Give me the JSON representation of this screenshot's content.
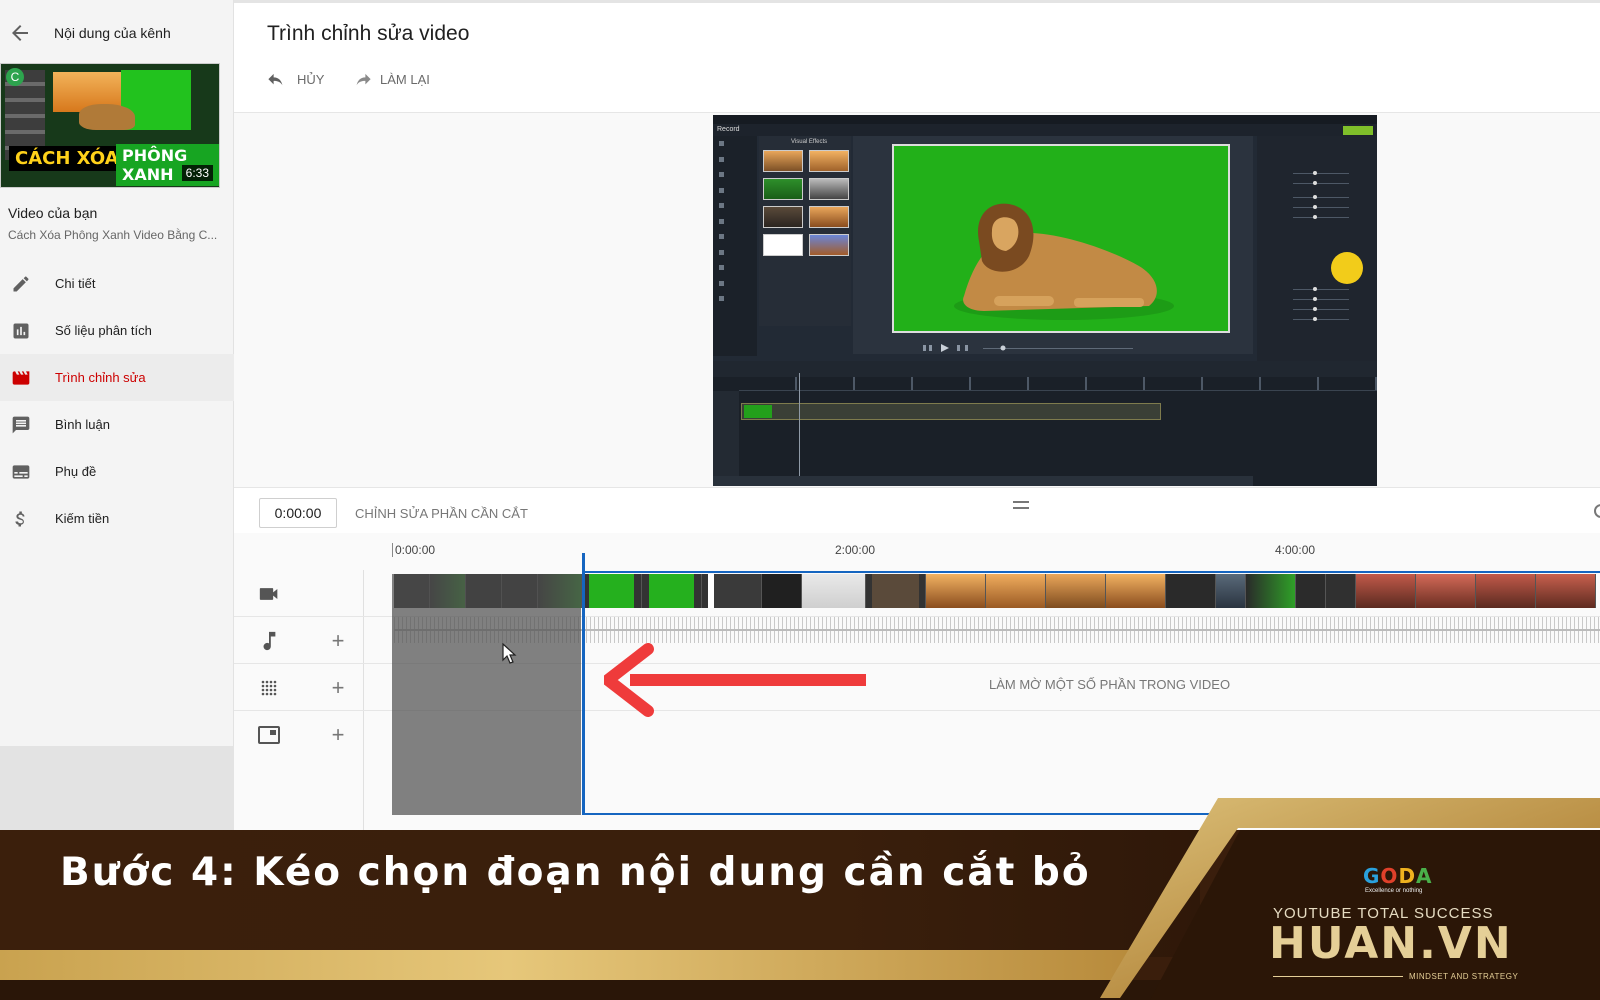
{
  "sidebar": {
    "back_label": "Nội dung của kênh",
    "thumbnail": {
      "caption_left": "CÁCH XÓA",
      "caption_right": "PHÔNG XANH",
      "duration": "6:33",
      "badge": "C"
    },
    "your_video_label": "Video của bạn",
    "video_title": "Cách Xóa Phông Xanh Video Bằng C...",
    "items": [
      {
        "label": "Chi tiết",
        "icon": "pencil-icon",
        "active": false
      },
      {
        "label": "Số liệu phân tích",
        "icon": "analytics-icon",
        "active": false
      },
      {
        "label": "Trình chỉnh sửa",
        "icon": "editor-clapper-icon",
        "active": true
      },
      {
        "label": "Bình luận",
        "icon": "comments-icon",
        "active": false
      },
      {
        "label": "Phụ đề",
        "icon": "subtitles-icon",
        "active": false
      },
      {
        "label": "Kiếm tiền",
        "icon": "dollar-icon",
        "active": false
      }
    ],
    "active_color": "#cc0000"
  },
  "header": {
    "title": "Trình chỉnh sửa video",
    "undo_label": "HỦY",
    "redo_label": "LÀM LẠI"
  },
  "editor": {
    "time_value": "0:00:00",
    "trim_label": "CHỈNH SỬA PHẦN CẦN CẮT",
    "ruler_ticks": [
      "0:00:00",
      "2:00:00",
      "4:00:00"
    ],
    "blur_label": "LÀM MỜ MỘT SỐ PHẦN TRONG VIDEO",
    "track_icons": [
      "video-camera-icon",
      "music-note-icon",
      "blur-grid-icon",
      "end-screen-icon"
    ],
    "accent": "#1565c0",
    "arrow_color": "#ef3b3b"
  },
  "preview": {
    "panel_title": "Visual Effects",
    "record_label": "Record"
  },
  "banner": {
    "text": "Bước 4: Kéo chọn đoạn nội dung cần cắt bỏ",
    "brand_goda": "GODA",
    "brand_tagline": "Excellence or nothing",
    "brand_line1": "YOUTUBE TOTAL SUCCESS",
    "brand_name": "HUAN.VN",
    "brand_subtitle": "MINDSET AND STRATEGY"
  }
}
